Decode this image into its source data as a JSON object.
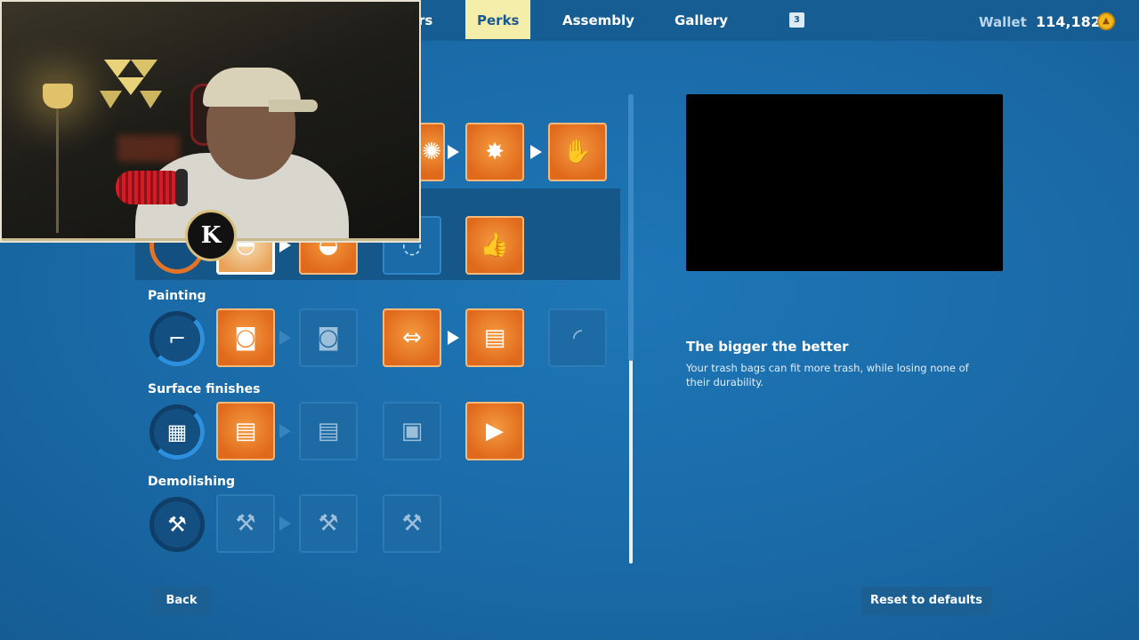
{
  "nav": {
    "partial_tab": "rs",
    "tabs": [
      "Perks",
      "Assembly",
      "Gallery"
    ],
    "active_tab": "Perks",
    "badge": "3",
    "wallet_label": "Wallet",
    "wallet_value": "114,182"
  },
  "sections": {
    "painting": "Painting",
    "surface_finishes": "Surface finishes",
    "demolishing": "Demolishing"
  },
  "detail": {
    "title": "The bigger the better",
    "description": "Your trash bags can fit more trash, while losing none of their durability."
  },
  "buttons": {
    "back": "Back",
    "reset": "Reset to defaults"
  },
  "webcam": {
    "logo_letter": "K"
  },
  "colors": {
    "background": "#1a6aa7",
    "active_tab": "#f5eeaa",
    "perk_unlocked": "#e06a1c",
    "perk_locked": "#1d6aa4"
  }
}
